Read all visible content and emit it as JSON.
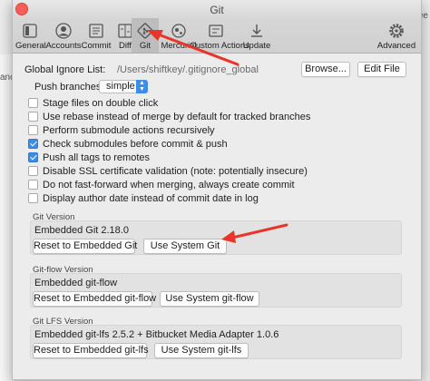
{
  "background": {
    "left_text": "ance",
    "right_text": "etree"
  },
  "window": {
    "title": "Git"
  },
  "toolbar": {
    "items": [
      {
        "label": "General",
        "icon": "general-icon"
      },
      {
        "label": "Accounts",
        "icon": "accounts-icon"
      },
      {
        "label": "Commit",
        "icon": "commit-icon"
      },
      {
        "label": "Diff",
        "icon": "diff-icon"
      },
      {
        "label": "Git",
        "icon": "git-icon",
        "active": true
      },
      {
        "label": "Mercurial",
        "icon": "mercurial-icon"
      },
      {
        "label": "Custom Actions",
        "icon": "custom-actions-icon"
      },
      {
        "label": "Update",
        "icon": "update-icon"
      },
      {
        "label": "Advanced",
        "icon": "gear-icon"
      }
    ]
  },
  "global_ignore": {
    "label": "Global Ignore List:",
    "path": "/Users/shiftkey/.gitignore_global",
    "browse_label": "Browse...",
    "edit_label": "Edit File"
  },
  "push_branches": {
    "label": "Push branches:",
    "value": "simple"
  },
  "options": [
    {
      "label": "Stage files on double click",
      "checked": false
    },
    {
      "label": "Use rebase instead of merge by default for tracked branches",
      "checked": false
    },
    {
      "label": "Perform submodule actions recursively",
      "checked": false
    },
    {
      "label": "Check submodules before commit & push",
      "checked": true
    },
    {
      "label": "Push all tags to remotes",
      "checked": true
    },
    {
      "label": "Disable SSL certificate validation (note: potentially insecure)",
      "checked": false
    },
    {
      "label": "Do not fast-forward when merging, always create commit",
      "checked": false
    },
    {
      "label": "Display author date instead of commit date in log",
      "checked": false
    }
  ],
  "git_version": {
    "title": "Git Version",
    "value": "Embedded Git 2.18.0",
    "reset_label": "Reset to Embedded Git",
    "system_label": "Use System Git"
  },
  "gitflow_version": {
    "title": "Git-flow Version",
    "value": "Embedded git-flow",
    "reset_label": "Reset to Embedded git-flow",
    "system_label": "Use System git-flow"
  },
  "gitlfs_version": {
    "title": "Git LFS Version",
    "value": "Embedded git-lfs 2.5.2 + Bitbucket Media Adapter 1.0.6",
    "reset_label": "Reset to Embedded git-lfs",
    "system_label": "Use System git-lfs"
  },
  "colors": {
    "accent": "#3b8de8",
    "annotation_arrow": "#e8342a"
  }
}
